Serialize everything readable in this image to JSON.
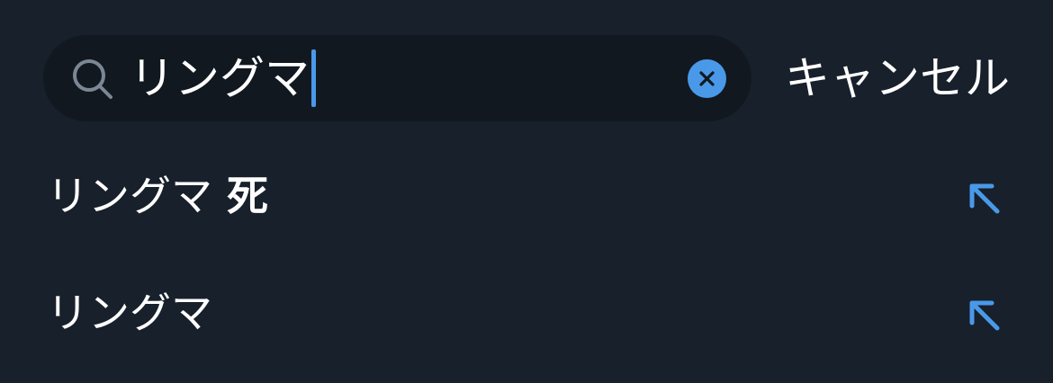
{
  "search": {
    "query": "リングマ",
    "search_icon": "search-icon",
    "clear_icon": "clear-icon"
  },
  "cancel_label": "キャンセル",
  "suggestions": [
    {
      "prefix": "リングマ",
      "suffix": " 死",
      "icon": "arrow-up-left-icon"
    },
    {
      "prefix": "リングマ",
      "suffix": "",
      "icon": "arrow-up-left-icon"
    }
  ],
  "colors": {
    "background": "#18202b",
    "search_field": "#121820",
    "accent": "#4a99e9",
    "text": "#ffffff",
    "icon_muted": "#7b8794"
  }
}
